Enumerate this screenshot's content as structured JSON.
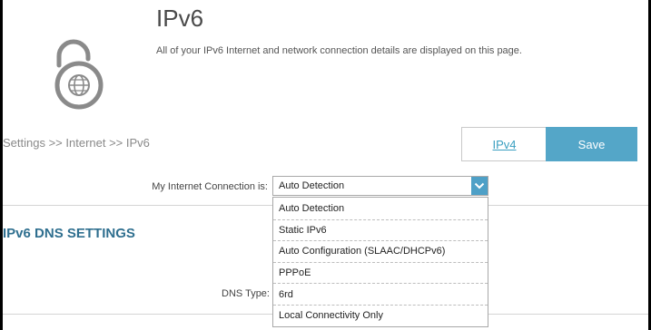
{
  "header": {
    "title": "IPv6",
    "description": "All of your IPv6 Internet and network connection details are displayed on this page.",
    "icon": "ipv6-lock-globe-icon"
  },
  "breadcrumb": "Settings >> Internet >> IPv6",
  "buttons": {
    "ipv4": "IPv4",
    "save": "Save"
  },
  "connection": {
    "label": "My Internet Connection is:",
    "selected": "Auto Detection",
    "options": [
      "Auto Detection",
      "Static IPv6",
      "Auto Configuration (SLAAC/DHCPv6)",
      "PPPoE",
      "6rd",
      "Local Connectivity Only"
    ]
  },
  "dns_section": {
    "title": "IPv6 DNS SETTINGS",
    "dns_type_label": "DNS Type:"
  },
  "colors": {
    "accent": "#54a6c8",
    "section_title": "#2f6f8f",
    "icon": "#8a8a8a"
  }
}
